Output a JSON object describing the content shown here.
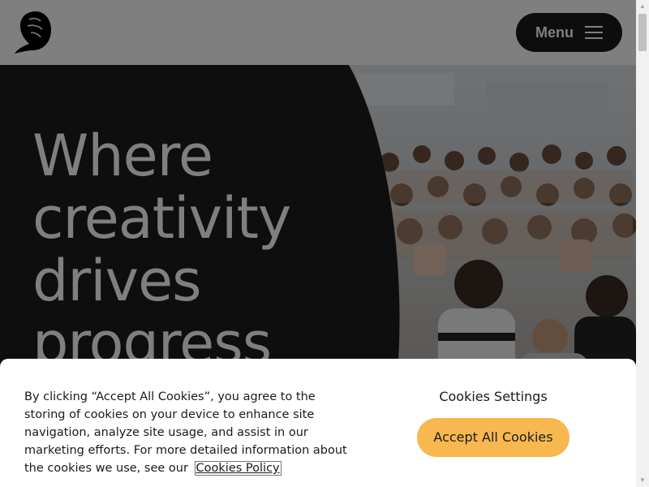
{
  "header": {
    "logo_icon": "lion-logo-icon",
    "menu_label": "Menu",
    "menu_icon": "hamburger-icon"
  },
  "hero": {
    "headline_lines": [
      "Where",
      "creativity",
      "drives",
      "progress"
    ],
    "image_description_icon": "crowd-photo"
  },
  "cookie_banner": {
    "text": "By clicking “Accept All Cookies”, you agree to the storing of cookies on your device to enhance site navigation, analyze site usage, and assist in our marketing efforts. For more detailed information about the cookies we use, see our",
    "policy_link": "Cookies Policy",
    "settings_label": "Cookies Settings",
    "accept_label": "Accept All Cookies"
  },
  "colors": {
    "accent": "#f7b84f",
    "menu_bg": "#1a1a1a",
    "hero_bg": "#1c1c1c"
  }
}
